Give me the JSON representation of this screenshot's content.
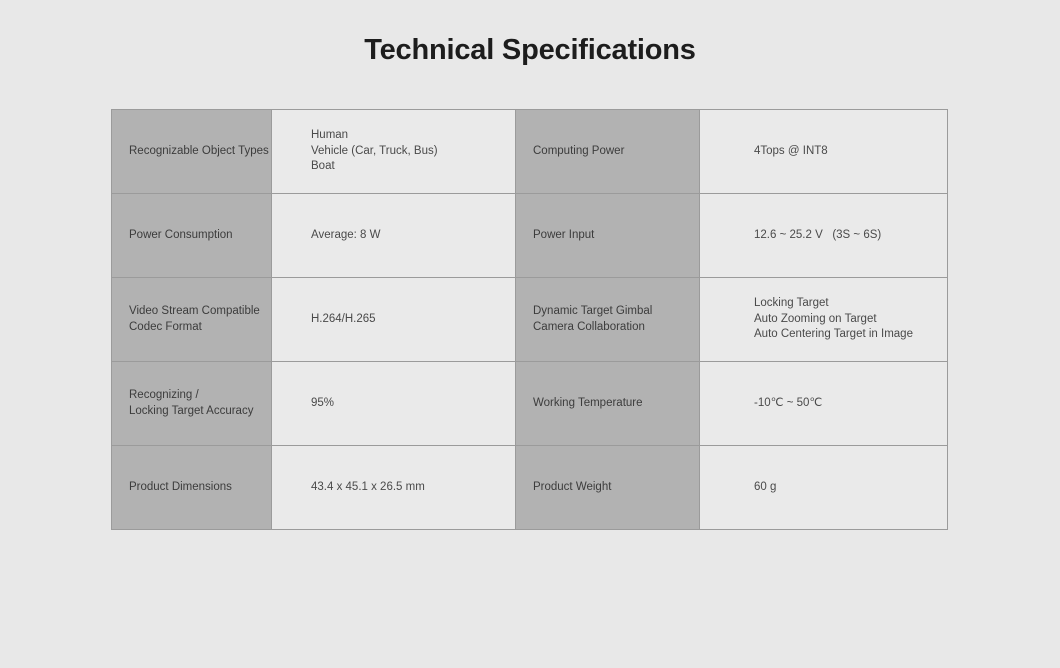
{
  "page": {
    "title": "Technical Specifications",
    "background_color": "#e8e8e8"
  },
  "colors": {
    "label_cell_bg": "#b2b2b2",
    "value_cell_bg": "#eaeaea",
    "label_text": "#3c3c3c",
    "value_text": "#4a4a4a",
    "title_text": "#1d1d1d",
    "table_outer_border": "#6c6c6c",
    "table_inner_border": "#9b9b9b"
  },
  "spec_table": {
    "rows": [
      {
        "left_label": "Recognizable Object Types",
        "left_value": [
          "Human",
          "Vehicle (Car, Truck, Bus)",
          "Boat"
        ],
        "right_label": "Computing Power",
        "right_value": [
          "4Tops @ INT8"
        ]
      },
      {
        "left_label": "Power Consumption",
        "left_value": [
          "Average: 8 W"
        ],
        "right_label": "Power Input",
        "right_value": [
          "12.6 ~ 25.2 V   (3S ~ 6S)"
        ]
      },
      {
        "left_label": "Video Stream Compatible\nCodec Format",
        "left_label_lines": [
          "Video Stream Compatible",
          "Codec Format"
        ],
        "left_value": [
          "H.264/H.265"
        ],
        "right_label_lines": [
          "Dynamic Target Gimbal",
          "Camera Collaboration"
        ],
        "right_label": "Dynamic Target Gimbal Camera Collaboration",
        "right_value": [
          "Locking Target",
          "Auto Zooming on Target",
          "Auto Centering Target in Image"
        ]
      },
      {
        "left_label_lines": [
          "Recognizing /",
          "Locking Target Accuracy"
        ],
        "left_label": "Recognizing / Locking Target Accuracy",
        "left_value": [
          "95%"
        ],
        "right_label": "Working Temperature",
        "right_value": [
          "-10℃ ~ 50℃"
        ]
      },
      {
        "left_label": "Product Dimensions",
        "left_value": [
          "43.4 x 45.1 x 26.5 mm"
        ],
        "right_label": "Product Weight",
        "right_value": [
          "60 g"
        ]
      }
    ]
  }
}
